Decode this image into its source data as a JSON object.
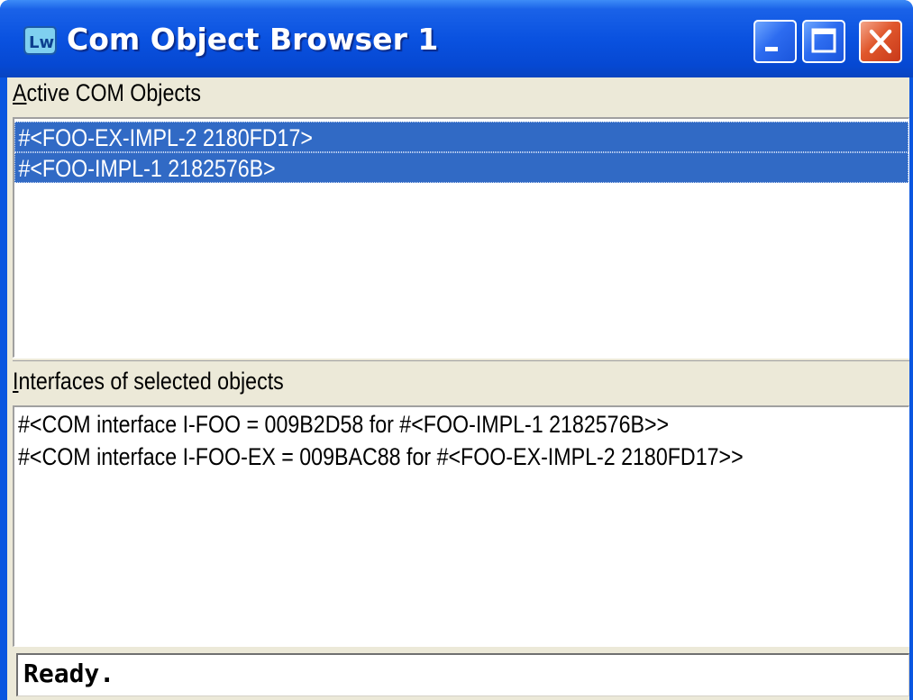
{
  "window": {
    "title": "Com Object Browser 1",
    "app_icon": "lispworks-icon",
    "controls": {
      "minimize": "minimize-icon",
      "maximize": "maximize-icon",
      "close": "close-icon"
    }
  },
  "active_objects": {
    "label_accel": "A",
    "label_rest": "ctive COM Objects",
    "items": [
      {
        "label": "#<FOO-EX-IMPL-2 2180FD17>",
        "selected": true
      },
      {
        "label": "#<FOO-IMPL-1 2182576B>",
        "selected": true
      }
    ]
  },
  "interfaces": {
    "label_accel": "I",
    "label_rest": "nterfaces of selected objects",
    "items": [
      "#<COM interface I-FOO = 009B2D58 for #<FOO-IMPL-1 2182576B>>",
      "#<COM interface I-FOO-EX = 009BAC88 for #<FOO-EX-IMPL-2 2180FD17>>"
    ]
  },
  "status": {
    "text": "Ready."
  },
  "colors": {
    "title_bar": "#0a52e0",
    "selection": "#316ac5",
    "client_bg": "#ece9d8",
    "close_button": "#e0572c"
  }
}
